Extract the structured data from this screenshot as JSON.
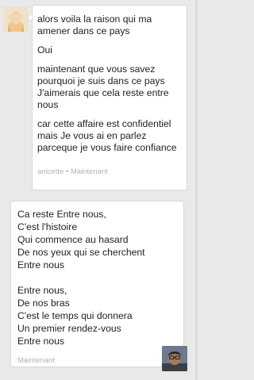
{
  "incoming": {
    "avatar_icon": "user-avatar-blonde",
    "messages": [
      "alors voila la raison qui ma amener dans ce pays",
      "Oui",
      "maintenant que vous savez pourquoi je suis dans ce pays J'aimerais que cela reste entre nous",
      "car cette affaire est confidentiel mais Je vous ai en parlez parceque je vous faire confiance"
    ],
    "meta": "anicette • Maintenant"
  },
  "outgoing": {
    "avatar_icon": "user-avatar-man-glasses",
    "messages": [
      "Ca reste Entre nous,\nC'est l'histoire\nQui commence au hasard\nDe nos yeux qui se cherchent\nEntre nous",
      "Entre nous,\nDe nos bras\nC'est le temps qui donnera\nUn premier rendez-vous\nEntre nous"
    ],
    "meta": "Maintenant"
  },
  "colors": {
    "background": "#e9e9e9",
    "bubble": "#ffffff",
    "bubble_border": "#d7d7d7",
    "text": "#222222",
    "meta_text": "#b3b3b3"
  }
}
